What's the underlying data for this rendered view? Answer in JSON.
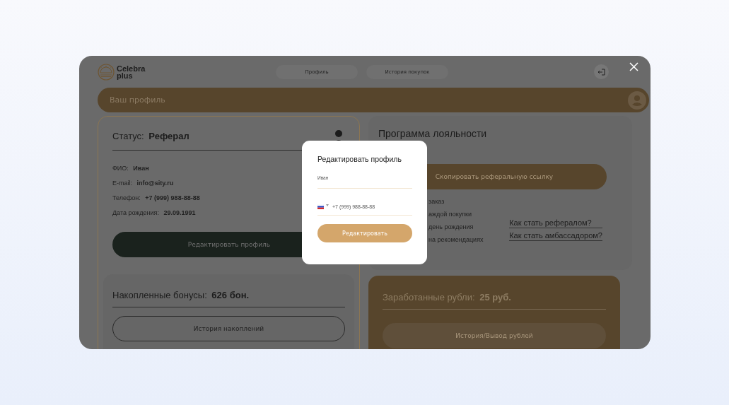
{
  "logo": {
    "line1": "Celebra",
    "line2": "plus"
  },
  "nav_tabs": [
    {
      "label": "Профиль",
      "selected": false
    },
    {
      "label": "История покупок",
      "selected": false
    }
  ],
  "profile_bar": {
    "title": "Ваш профиль"
  },
  "status_card": {
    "label": "Статус:",
    "value": "Реферал",
    "fields": [
      {
        "label": "ФИО:",
        "value": "Иван"
      },
      {
        "label": "E-mail:",
        "value": "info@sity.ru"
      },
      {
        "label": "Телефон:",
        "value": "+7 (999) 988-88-88"
      },
      {
        "label": "Дата рождения:",
        "value": "29.09.1991"
      }
    ],
    "button": "Редактировать профиль"
  },
  "bonus_card": {
    "label": "Накопленные бонусы:",
    "value": "626 бон.",
    "button": "История накоплений"
  },
  "loyalty_card": {
    "title": "Программа лояльности",
    "button": "Скопировать реферальную ссылку",
    "items": [
      "заказ",
      "аждой покупки",
      "день рождения",
      "на рекомендациях"
    ],
    "links": [
      "Как стать рефералом?",
      "Как стать амбассадором?"
    ]
  },
  "rubles_card": {
    "label": "Заработанные рубли:",
    "value": "25 руб.",
    "button": "История/Вывод рублей"
  },
  "modal": {
    "title": "Редактировать профиль",
    "name_value": "Иван",
    "phone_value": "+7 (999) 988-88-88",
    "submit": "Редактировать"
  }
}
